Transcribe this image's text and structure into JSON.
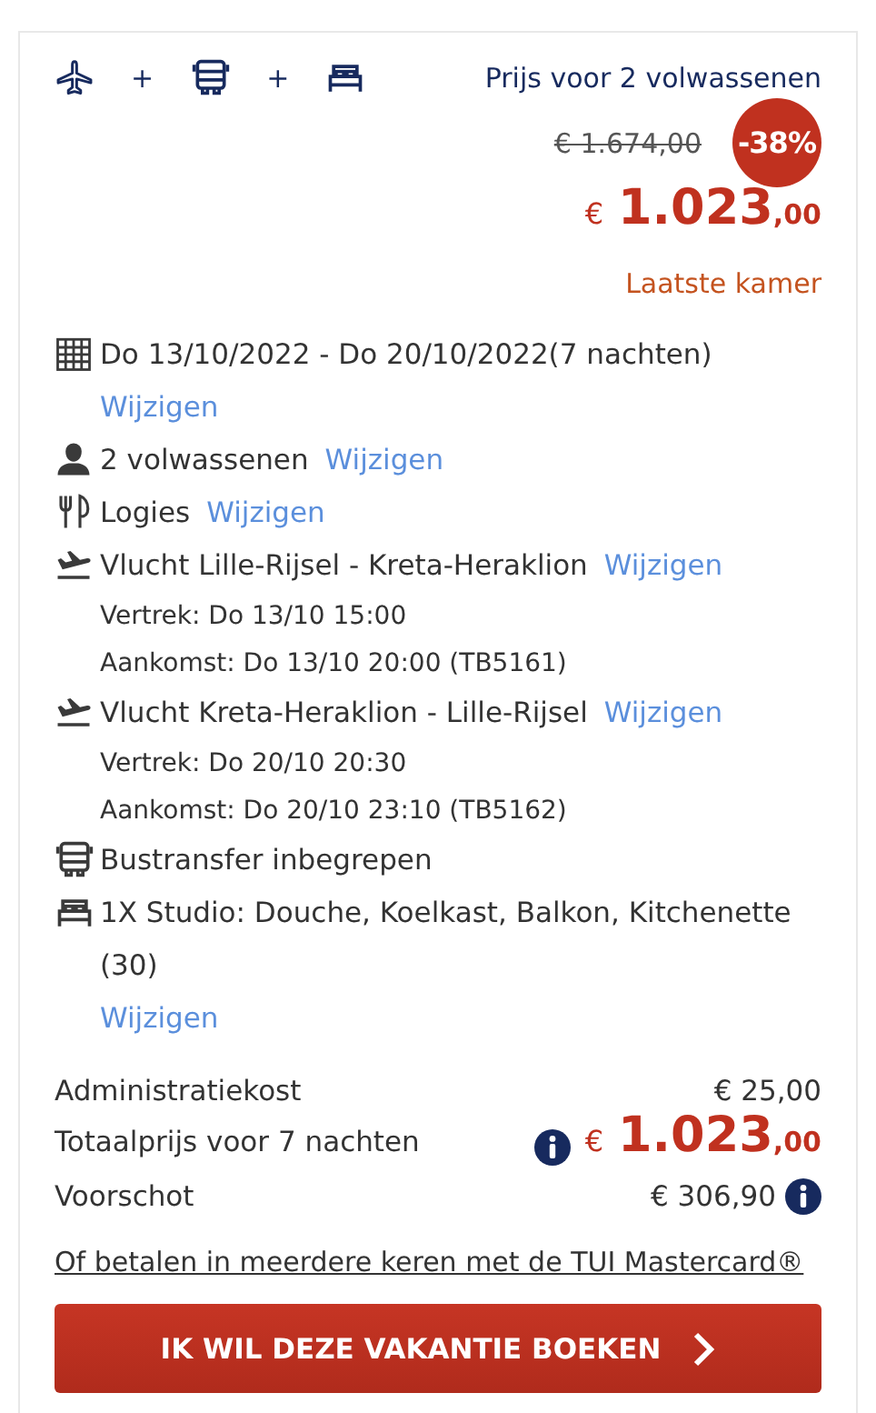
{
  "products": [
    {
      "kind": "plane"
    },
    {
      "kind": "plus",
      "text": "+"
    },
    {
      "kind": "bus"
    },
    {
      "kind": "plus",
      "text": "+"
    },
    {
      "kind": "bed"
    }
  ],
  "price": {
    "label": "Prijs voor 2 volwassenen",
    "old_price": "€ 1.674,00",
    "discount": "-38%",
    "currency": "€",
    "amount": "1.023",
    "cents": ",00",
    "availability": "Laatste kamer"
  },
  "details": [
    {
      "kind": "calendar",
      "text": "Do 13/10/2022 - Do 20/10/2022(7 nachten)",
      "link": "Wijzigen"
    },
    {
      "kind": "person",
      "text": "2 volwassenen",
      "link": "Wijzigen"
    },
    {
      "kind": "meal",
      "text": "Logies",
      "link": "Wijzigen"
    },
    {
      "kind": "flight",
      "text": "Vlucht Lille-Rijsel - Kreta-Heraklion",
      "link": "Wijzigen",
      "lines": [
        "Vertrek: Do 13/10 15:00",
        "Aankomst: Do 13/10 20:00 (TB5161)"
      ]
    },
    {
      "kind": "flight",
      "text": "Vlucht Kreta-Heraklion - Lille-Rijsel",
      "link": "Wijzigen",
      "lines": [
        "Vertrek: Do 20/10 20:30",
        "Aankomst: Do 20/10 23:10 (TB5162)"
      ]
    },
    {
      "kind": "bus",
      "text": "Bustransfer inbegrepen"
    },
    {
      "kind": "bed",
      "text": "1X Studio: Douche, Koelkast, Balkon, Kitchenette (30)",
      "link": "Wijzigen"
    }
  ],
  "summary": [
    {
      "kind": "plain",
      "label": "Administratiekost",
      "value": "€ 25,00"
    },
    {
      "kind": "total",
      "label": "Totaalprijs voor 7 nachten",
      "currency": "€",
      "amount": "1.023",
      "cents": ",00",
      "info": true
    },
    {
      "kind": "plain",
      "label": "Voorschot",
      "value": "€ 306,90",
      "info": true
    }
  ],
  "mastercard_link": "Of betalen in meerdere keren met de TUI Mastercard®",
  "book_button": "IK WIL DEZE VAKANTIE BOEKEN"
}
